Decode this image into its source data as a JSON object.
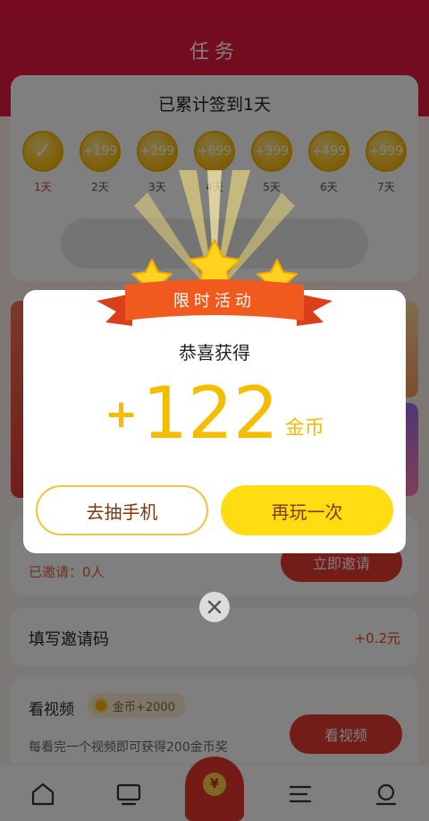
{
  "header": {
    "title": "任务"
  },
  "signin": {
    "title": "已累计签到1天",
    "days": [
      {
        "reward": "✓",
        "label": "1天"
      },
      {
        "reward": "+199",
        "label": "2天"
      },
      {
        "reward": "+299",
        "label": "3天"
      },
      {
        "reward": "+699",
        "label": "4天"
      },
      {
        "reward": "+399",
        "label": "5天"
      },
      {
        "reward": "+499",
        "label": "6天"
      },
      {
        "reward": "+999",
        "label": "7天"
      }
    ]
  },
  "invite": {
    "invited_text": "已邀请：0人",
    "button_label": "立即邀请"
  },
  "invite_code": {
    "title": "填写邀请码",
    "reward": "+0.2元"
  },
  "video": {
    "title": "看视频",
    "badge": "金币+2000",
    "description": "每看完一个视频即可获得200金币奖",
    "button_label": "看视频"
  },
  "redpacket": {
    "symbol": "¥"
  },
  "modal": {
    "ribbon_text": "限时活动",
    "congrats": "恭喜获得",
    "plus": "+",
    "amount": "122",
    "unit": "金币",
    "secondary_button": "去抽手机",
    "primary_button": "再玩一次"
  },
  "colors": {
    "header_red": "#ec1740",
    "accent_yellow": "#ffdd12",
    "amount_gold": "#f5bd00",
    "ribbon_orange": "#f05a1e"
  }
}
